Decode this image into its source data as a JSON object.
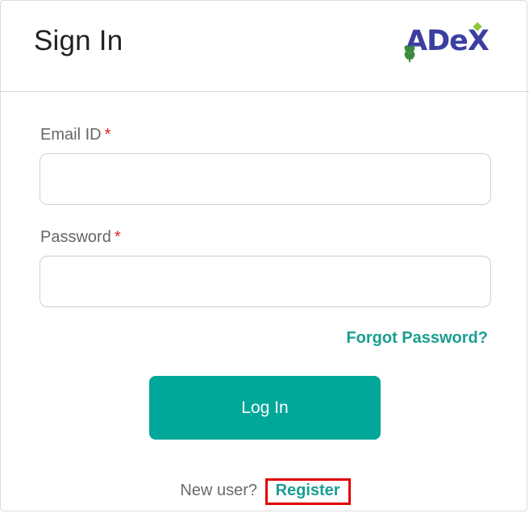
{
  "header": {
    "title": "Sign In",
    "logo_text": "ADeX"
  },
  "form": {
    "email_label": "Email ID",
    "password_label": "Password",
    "required_marker": "*",
    "email_value": "",
    "password_value": "",
    "forgot_label": "Forgot Password?",
    "login_label": "Log In"
  },
  "footer": {
    "new_user_text": "New user?",
    "register_label": "Register"
  },
  "colors": {
    "accent": "#01a899",
    "link": "#1a9e92",
    "brand": "#3b3fa0",
    "required": "#e02020",
    "highlight_border": "#e00000"
  },
  "icons": [
    "wheat-leaf-icon",
    "diamond-icon"
  ]
}
